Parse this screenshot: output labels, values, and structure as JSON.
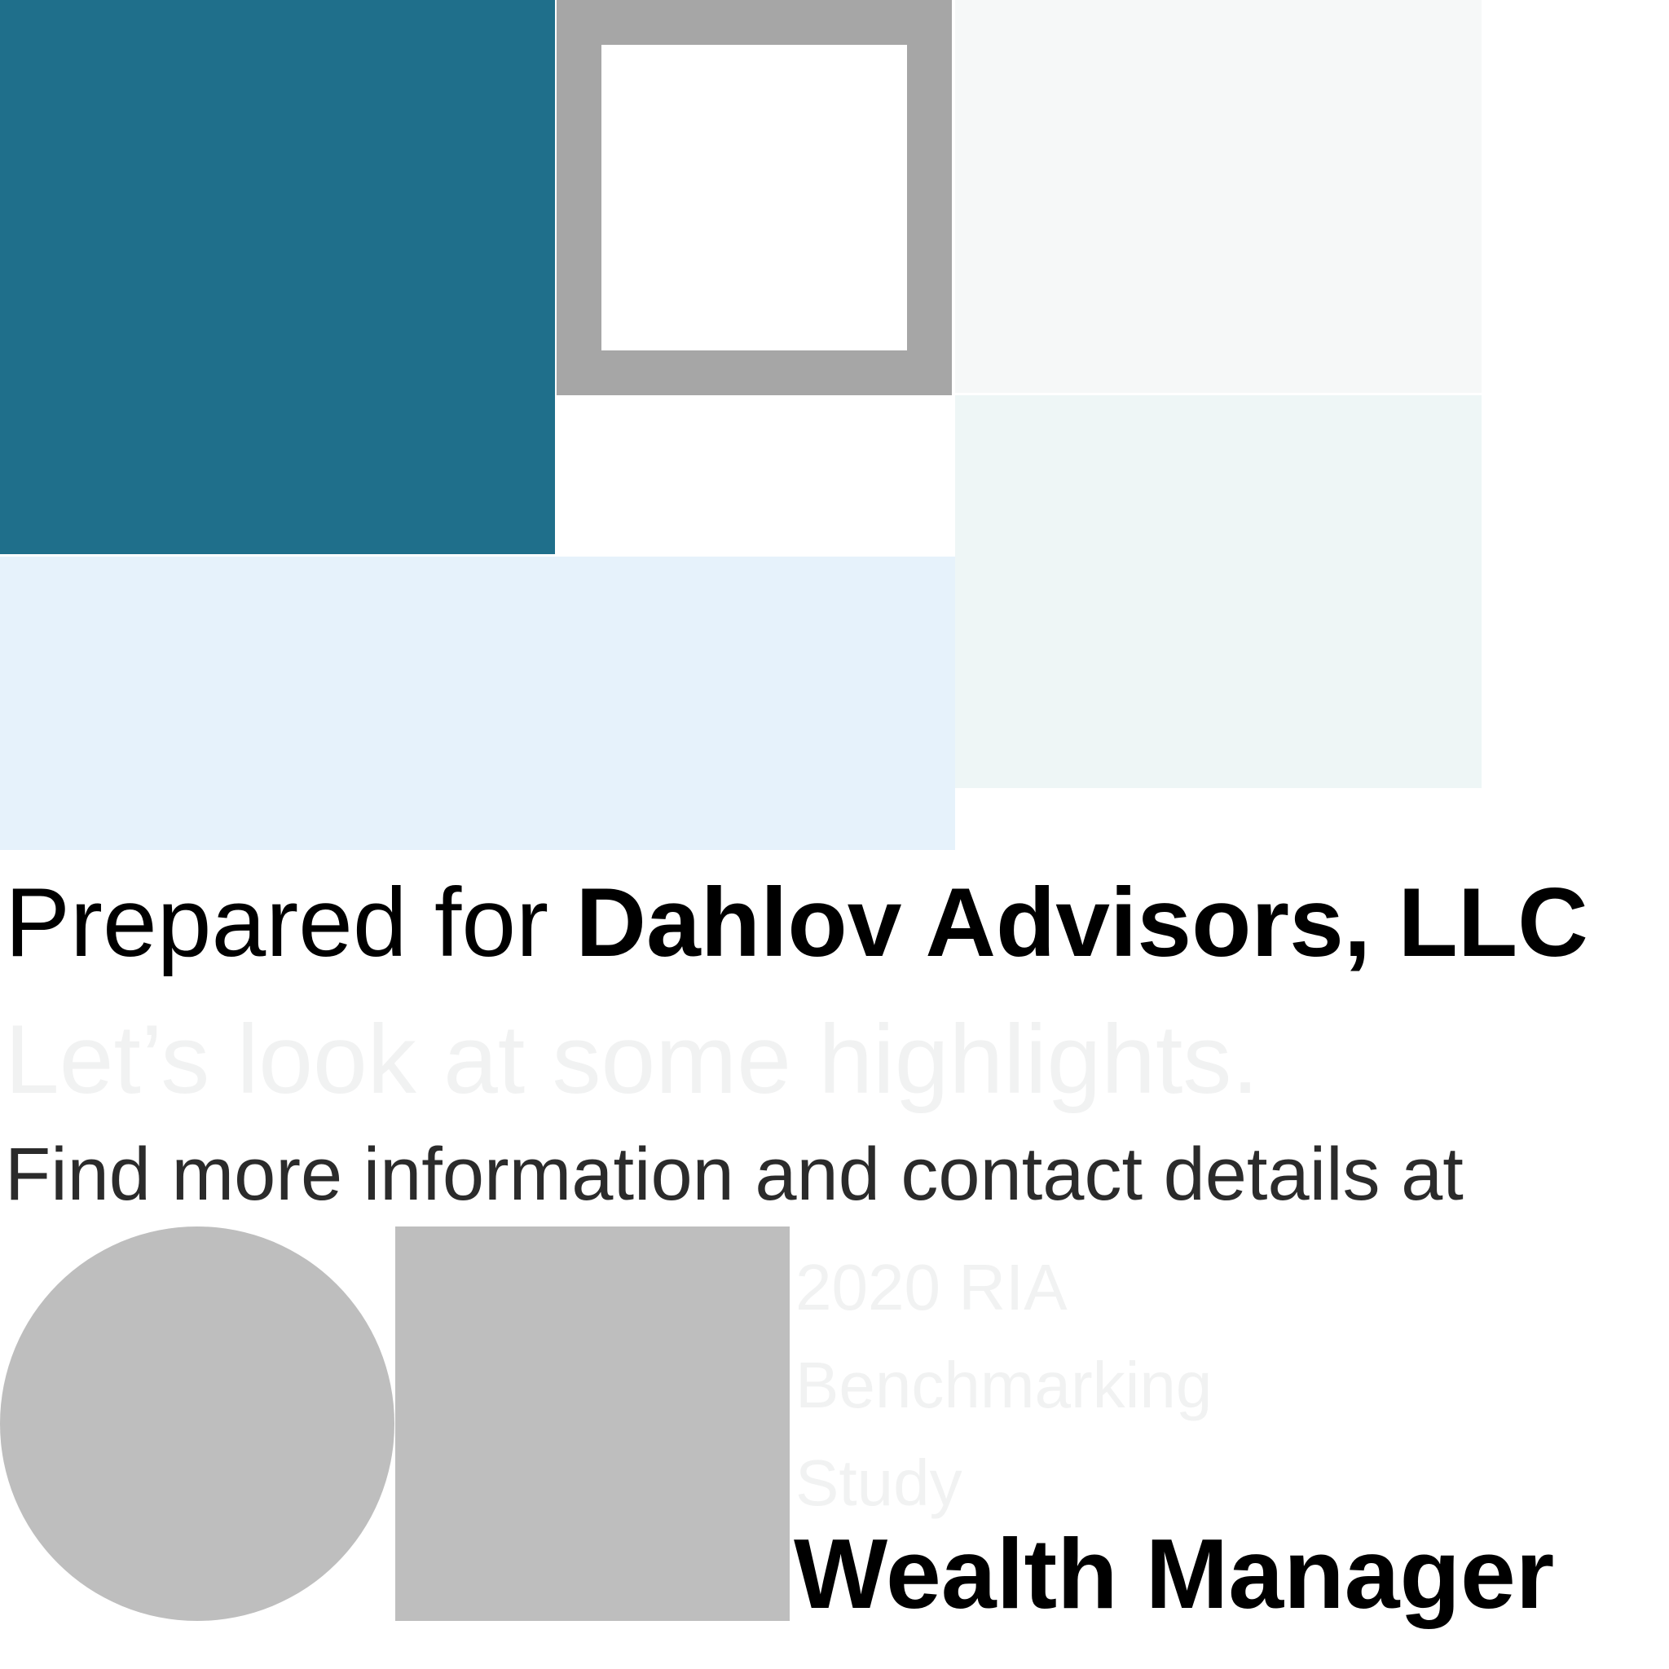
{
  "colors": {
    "teal": "#1f6f8b",
    "frame_grey": "#a6a6a6",
    "pale_grey": "#f6f8f8",
    "pale_mint": "#eef6f6",
    "sky": "#e6f2fb",
    "placeholder_grey": "#bebebe"
  },
  "header": {
    "prepared_prefix": "Prepared for ",
    "client_name": "Dahlov Advisors, LLC"
  },
  "highlights_text": "Let’s look at some highlights.",
  "info_text": "Find more information and contact details at",
  "study": {
    "title_lines": [
      "2020 RIA",
      "Benchmarking",
      "Study"
    ]
  },
  "brand": {
    "name": "Wealth Manager"
  }
}
